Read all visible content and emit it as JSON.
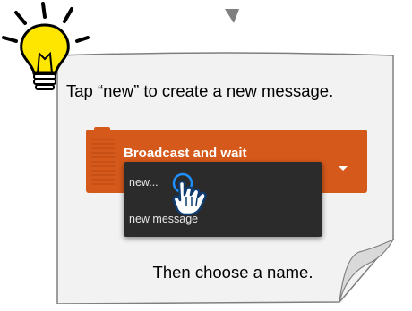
{
  "tip": {
    "instruction": "Tap “new” to create a new message.",
    "followup": "Then choose a name.",
    "icon": "lightbulb-icon"
  },
  "block": {
    "label": "Broadcast and wait",
    "color": "#d5591a"
  },
  "menu": {
    "items": [
      {
        "label": "new..."
      },
      {
        "label": "new message"
      }
    ],
    "background": "#2b2b2b"
  },
  "colors": {
    "note_fill": "#f2f2f2",
    "note_border": "#7f7f7f",
    "bulb_fill": "#ffe600",
    "hand_fill": "#ffffff",
    "touch_ring": "#1e90ff"
  }
}
